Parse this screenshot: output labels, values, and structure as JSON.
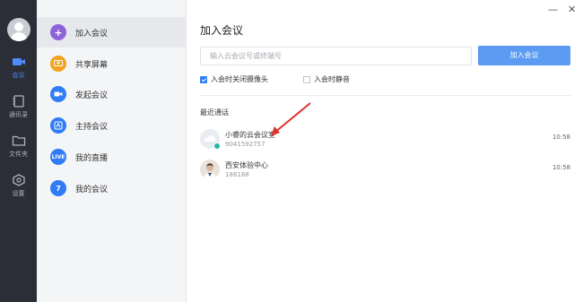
{
  "window": {
    "minimize": "—",
    "close": "✕"
  },
  "rail": {
    "items": [
      {
        "label": "会议",
        "icon": "video-camera-icon",
        "active": true
      },
      {
        "label": "通讯录",
        "icon": "contacts-icon",
        "active": false
      },
      {
        "label": "文件夹",
        "icon": "folder-icon",
        "active": false
      },
      {
        "label": "设置",
        "icon": "settings-icon",
        "active": false
      }
    ]
  },
  "sidebar": {
    "items": [
      {
        "label": "加入会议",
        "icon": "plus-icon",
        "color": "#8e63d9",
        "active": true
      },
      {
        "label": "共享屏幕",
        "icon": "share-screen-icon",
        "color": "#f0a41f",
        "active": false
      },
      {
        "label": "发起会议",
        "icon": "video-icon",
        "color": "#2f7cf6",
        "active": false
      },
      {
        "label": "主持会议",
        "icon": "host-icon",
        "color": "#2f7cf6",
        "active": false
      },
      {
        "label": "我的直播",
        "icon": "live-icon",
        "color": "#2f7cf6",
        "active": false
      },
      {
        "label": "我的会议",
        "icon": "calendar-icon",
        "color": "#2f7cf6",
        "active": false
      }
    ],
    "live_badge": "LIVE",
    "calendar_num": "7"
  },
  "main": {
    "title": "加入会议",
    "input_placeholder": "输入云会议号或终端号",
    "join_button": "加入会议",
    "options": [
      {
        "label": "入会时关闭摄像头",
        "checked": true
      },
      {
        "label": "入会时静音",
        "checked": false
      }
    ],
    "recent_heading": "最近通话",
    "recent": [
      {
        "name": "小睿的云会议室",
        "sub": "9041592757",
        "time": "10:58",
        "avatar": "cloud-avatar"
      },
      {
        "name": "西安体验中心",
        "sub": "188188",
        "time": "10:58",
        "avatar": "person-avatar"
      }
    ]
  },
  "colors": {
    "accent": "#2f7cf6",
    "button": "#5b9bf2",
    "rail": "#2b2e36",
    "annotation": "#e03030"
  }
}
